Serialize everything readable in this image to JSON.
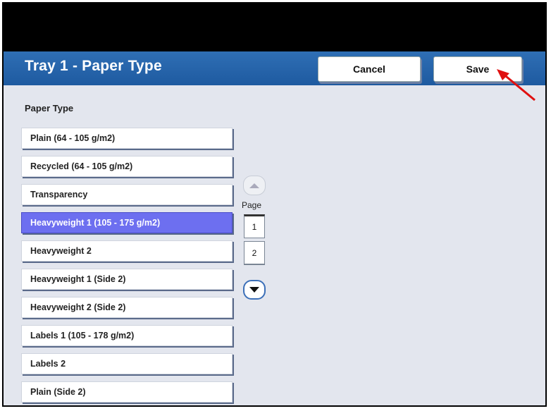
{
  "header": {
    "title": "Tray 1 - Paper Type",
    "cancel_label": "Cancel",
    "save_label": "Save"
  },
  "section_label": "Paper Type",
  "paper_types": [
    "Plain (64 - 105 g/m2)",
    "Recycled (64 - 105 g/m2)",
    "Transparency",
    "Heavyweight 1 (105 - 175 g/m2)",
    "Heavyweight 2",
    "Heavyweight 1 (Side 2)",
    "Heavyweight 2 (Side 2)",
    "Labels 1 (105 - 178 g/m2)",
    "Labels 2",
    "Plain (Side 2)"
  ],
  "selected_index": 3,
  "pager": {
    "label": "Page",
    "pages": [
      "1",
      "2"
    ]
  },
  "colors": {
    "title_bar": "#1e5aa0",
    "selected_item": "#6d6ff0",
    "annotation_arrow": "#e01010"
  }
}
